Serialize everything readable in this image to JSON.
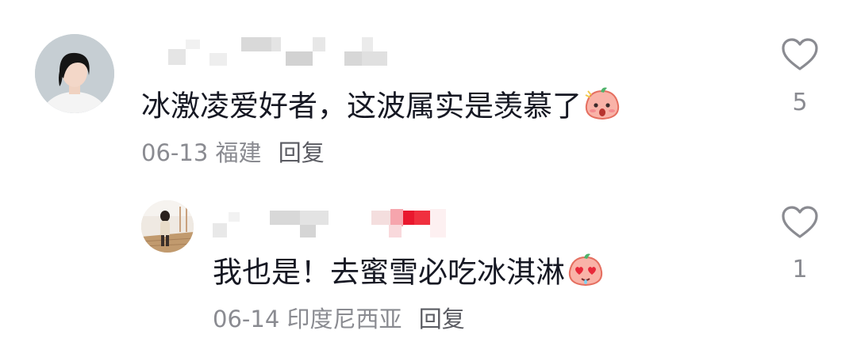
{
  "comments": [
    {
      "text": "冰激凌爱好者，这波属实是羡慕了",
      "date": "06-13",
      "location": "福建",
      "reply_label": "回复",
      "likes": "5",
      "emoji": "peach-shocked-emoji"
    },
    {
      "text": "我也是！去蜜雪必吃冰淇淋",
      "date": "06-14",
      "location": "印度尼西亚",
      "reply_label": "回复",
      "likes": "1",
      "emoji": "peach-heart-eyes-emoji"
    }
  ],
  "icons": {
    "like": "heart-outline-icon"
  },
  "colors": {
    "text_primary": "#161823",
    "text_secondary": "#8a8b91",
    "heart_stroke": "#8a8b91"
  }
}
